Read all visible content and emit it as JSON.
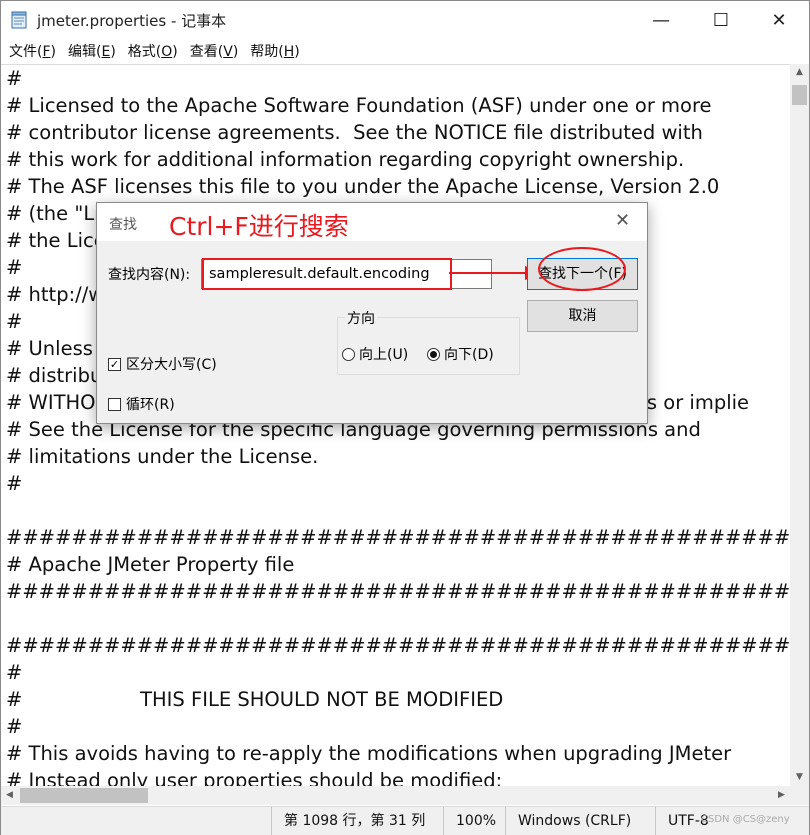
{
  "window": {
    "title": "jmeter.properties - 记事本",
    "minimize": "—",
    "maximize": "☐",
    "close": "✕"
  },
  "menu": [
    {
      "label": "文件(",
      "key": "F",
      "end": ")"
    },
    {
      "label": "编辑(",
      "key": "E",
      "end": ")"
    },
    {
      "label": "格式(",
      "key": "O",
      "end": ")"
    },
    {
      "label": "查看(",
      "key": "V",
      "end": ")"
    },
    {
      "label": "帮助(",
      "key": "H",
      "end": ")"
    }
  ],
  "editor": {
    "lines": [
      "#",
      "# Licensed to the Apache Software Foundation (ASF) under one or more",
      "# contributor license agreements.  See the NOTICE file distributed with",
      "# this work for additional information regarding copyright ownership.",
      "# The ASF licenses this file to you under the Apache License, Version 2.0",
      "# (the \"Lic                                                                                     n",
      "# the Lice",
      "#",
      "# http://w",
      "#",
      "# Unless r                                                                                  e",
      "# distribu",
      "# WITHOU                                                                              xpress or implie",
      "# See the License for the specific language governing permissions and",
      "# limitations under the License.",
      "#",
      "",
      "########################################################################################",
      "# Apache JMeter Property file",
      "########################################################################################",
      "",
      "########################################################################################",
      "#",
      "#                   THIS FILE SHOULD NOT BE MODIFIED",
      "#",
      "# This avoids having to re-apply the modifications when upgrading JMeter",
      "# Instead only user properties should be modified:"
    ]
  },
  "status": {
    "position": "第 1098 行，第 31 列",
    "zoom": "100%",
    "line_ending": "Windows (CRLF)",
    "encoding": "UTF-8",
    "watermark": "CSDN @CS@zeny"
  },
  "find_dialog": {
    "title": "查找",
    "annotation": "Ctrl+F进行搜索",
    "find_label": "查找内容(N):",
    "find_value": "sampleresult.default.encoding",
    "find_next": "查找下一个(F)",
    "cancel": "取消",
    "direction_label": "方向",
    "up_label": "向上(U)",
    "down_label": "向下(D)",
    "direction_selected": "down",
    "match_case_label": "区分大小写(C)",
    "match_case_checked": true,
    "wrap_label": "循环(R)",
    "wrap_checked": false,
    "close": "✕",
    "highlight_color": "#e8191f"
  }
}
